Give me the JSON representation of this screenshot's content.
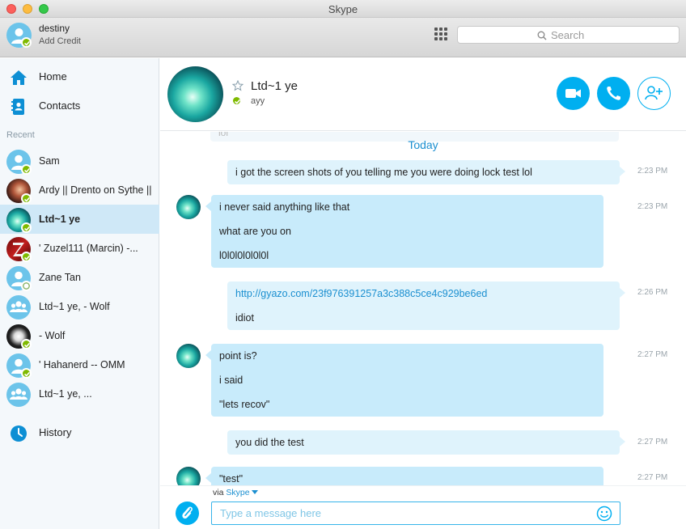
{
  "window": {
    "title": "Skype"
  },
  "me": {
    "name": "destiny",
    "credit": "Add Credit"
  },
  "search": {
    "placeholder": "Search"
  },
  "sidebar": {
    "nav": [
      {
        "label": "Home",
        "icon": "home-icon"
      },
      {
        "label": "Contacts",
        "icon": "contacts-book-icon"
      }
    ],
    "recent_label": "Recent",
    "contacts": [
      {
        "name": "Sam",
        "avatar": "default",
        "status": "online"
      },
      {
        "name": "Ardy || Drento on Sythe ||",
        "avatar": "photo",
        "status": "online"
      },
      {
        "name": "Ltd~1 ye",
        "avatar": "photo",
        "status": "online",
        "active": true
      },
      {
        "name": "' Zuzel111 (Marcin) -...",
        "avatar": "photo",
        "status": "online"
      },
      {
        "name": "Zane Tan",
        "avatar": "default",
        "status": "offline"
      },
      {
        "name": "Ltd~1 ye, - Wolf",
        "avatar": "group",
        "status": "none"
      },
      {
        "name": "- Wolf",
        "avatar": "photo",
        "status": "online"
      },
      {
        "name": "' Hahanerd -- OMM",
        "avatar": "default",
        "status": "online"
      },
      {
        "name": "Ltd~1 ye, ...",
        "avatar": "group",
        "status": "none"
      }
    ],
    "history_label": "History"
  },
  "conversation": {
    "name": "Ltd~1 ye",
    "mood": "ayy",
    "status_color": "#7fba00",
    "accent": "#00aff0"
  },
  "messages": {
    "ghost_text": "lol",
    "day_divider": "Today",
    "items": [
      {
        "dir": "out",
        "lines": [
          "i got the screen shots of you telling me you were doing lock test lol"
        ],
        "time": "2:23 PM"
      },
      {
        "dir": "in",
        "lines": [
          "i never said anything like that",
          "what are you on",
          "l0l0l0l0l0l0l"
        ],
        "time": "2:23 PM"
      },
      {
        "dir": "out",
        "lines": [
          "http://gyazo.com/23f976391257a3c388c5ce4c929be6ed",
          "idiot"
        ],
        "time": "2:26 PM"
      },
      {
        "dir": "in",
        "lines": [
          "point is?",
          "i said",
          "\"lets recov\""
        ],
        "time": "2:27 PM"
      },
      {
        "dir": "out",
        "lines": [
          "you did the test"
        ],
        "time": "2:27 PM"
      },
      {
        "dir": "in",
        "lines": [
          "\"test\""
        ],
        "time": "2:27 PM"
      }
    ]
  },
  "composer": {
    "via_prefix": "via",
    "via_service": "Skype",
    "placeholder": "Type a message here"
  }
}
